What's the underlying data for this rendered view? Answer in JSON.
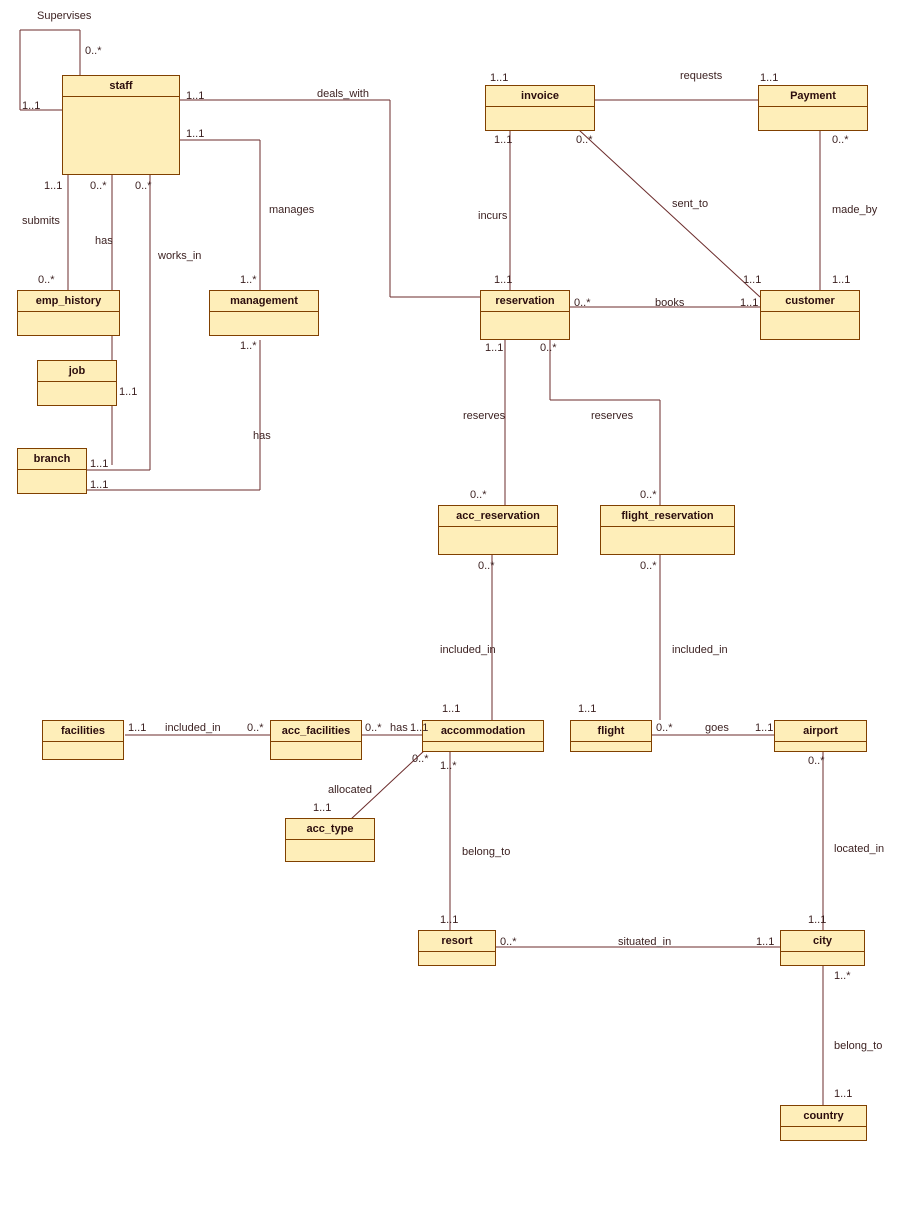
{
  "entities": {
    "staff": "staff",
    "emp_history": "emp_history",
    "job": "job",
    "branch": "branch",
    "management": "management",
    "invoice": "invoice",
    "payment": "Payment",
    "reservation": "reservation",
    "customer": "customer",
    "acc_reservation": "acc_reservation",
    "flight_reservation": "flight_reservation",
    "facilities": "facilities",
    "acc_facilities": "acc_facilities",
    "accommodation": "accommodation",
    "flight": "flight",
    "airport": "airport",
    "acc_type": "acc_type",
    "resort": "resort",
    "city": "city",
    "country": "country"
  },
  "labels": {
    "supervises": "Supervises",
    "deals_with": "deals_with",
    "requests": "requests",
    "submits": "submits",
    "has1": "has",
    "works_in": "works_in",
    "manages": "manages",
    "sent_to": "sent_to",
    "made_by": "made_by",
    "incurs": "incurs",
    "books": "books",
    "has2": "has",
    "reserves1": "reserves",
    "reserves2": "reserves",
    "included_in1": "included_in",
    "included_in2": "included_in",
    "included_in3": "included_in",
    "has3": "has",
    "goes": "goes",
    "allocated": "allocated",
    "belong_to1": "belong_to",
    "located_in": "located_in",
    "situated_in": "situated_in",
    "belong_to2": "belong_to"
  },
  "mult": {
    "m0s": "0..*",
    "m11": "1..1",
    "m1s": "1..*"
  }
}
